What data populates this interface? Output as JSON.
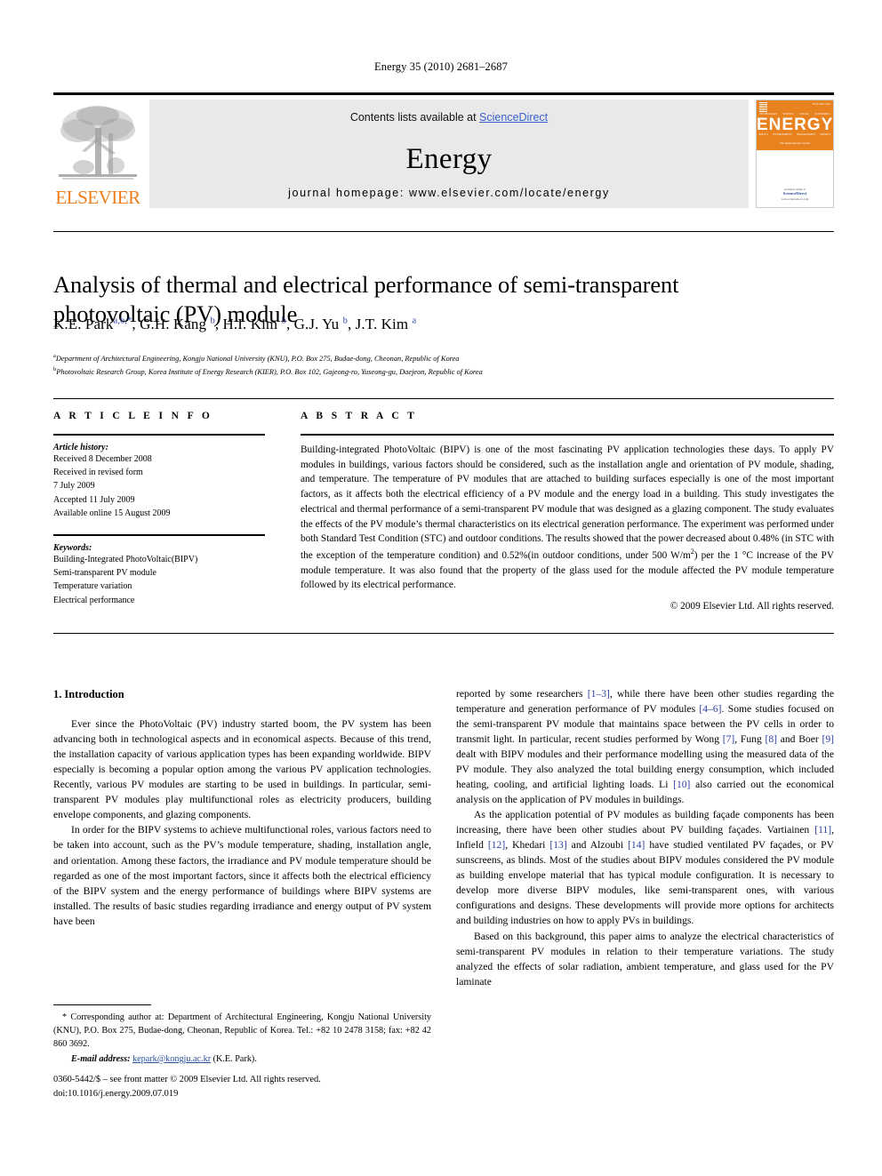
{
  "running_head": "Energy 35 (2010) 2681–2687",
  "masthead": {
    "publisher_wordmark": "ELSEVIER",
    "contents_prefix": "Contents lists available at ",
    "contents_link": "ScienceDirect",
    "journal_title": "Energy",
    "homepage": "journal homepage: www.elsevier.com/locate/energy",
    "cover": {
      "title": "ENERGY",
      "subtitle": "The International Journal",
      "issn": "ISSN 0360-5442",
      "topics_row1": [
        "TECHNOLOGY",
        "SCIENCE",
        "SOCIAL",
        "ECONOMICS"
      ],
      "topics_row2": [
        "POLICY",
        "ENVIRONMENT",
        "MANAGEMENT",
        "ENERGY"
      ],
      "footer_prefix": "Available online at",
      "footer_brand": "ScienceDirect",
      "footer_url": "www.sciencedirect.com"
    },
    "link_color": "#3a5fcd",
    "brand_orange": "#ef7d1a",
    "band_gray": "#e9e9e9"
  },
  "article": {
    "title": "Analysis of thermal and electrical performance of semi-transparent photovoltaic (PV) module",
    "authors_html": "K.E. Park<sup>a,b,*</sup>, G.H. Kang <sup>b</sup>, H.I. Kim <sup>b</sup>, G.J. Yu <sup>b</sup>, J.T. Kim <sup>a</sup>",
    "affiliations": [
      "Department of Architectural Engineering, Kongju National University (KNU), P.O. Box 275, Budae-dong, Cheonan, Republic of Korea",
      "Photovoltaic Research Group, Korea Institute of Energy Research (KIER), P.O. Box 102, Gajeong-ro, Yuseong-gu, Daejeon, Republic of Korea"
    ],
    "affiliation_markers": [
      "a",
      "b"
    ]
  },
  "article_info": {
    "heading": "A R T I C L E  I N F O",
    "history_label": "Article history:",
    "history": [
      "Received 8 December 2008",
      "Received in revised form",
      "7 July 2009",
      "Accepted 11 July 2009",
      "Available online 15 August 2009"
    ],
    "keywords_label": "Keywords:",
    "keywords": [
      "Building-Integrated PhotoVoltaic(BIPV)",
      "Semi-transparent PV module",
      "Temperature variation",
      "Electrical performance"
    ]
  },
  "abstract": {
    "heading": "A B S T R A C T",
    "body_html": "Building-integrated PhotoVoltaic (BIPV) is one of the most fascinating PV application technologies these days. To apply PV modules in buildings, various factors should be considered, such as the installation angle and orientation of PV module, shading, and temperature. The temperature of PV modules that are attached to building surfaces especially is one of the most important factors, as it affects both the electrical efficiency of a PV module and the energy load in a building. This study investigates the electrical and thermal performance of a semi-transparent PV module that was designed as a glazing component. The study evaluates the effects of the PV module&rsquo;s thermal characteristics on its electrical generation performance. The experiment was performed under both Standard Test Condition (STC) and outdoor conditions. The results showed that the power decreased about 0.48% (in STC with the exception of the temperature condition) and 0.52%(in outdoor conditions, under 500 W/m<sup>2</sup>) per the 1 &deg;C increase of the PV module temperature. It was also found that the property of the glass used for the module affected the PV module temperature followed by its electrical performance.",
    "copyright": "© 2009 Elsevier Ltd. All rights reserved."
  },
  "body": {
    "section_heading": "1.  Introduction",
    "left_paragraphs_html": [
      "Ever since the PhotoVoltaic (PV) industry started boom, the PV system has been advancing both in technological aspects and in economical aspects. Because of this trend, the installation capacity of various application types has been expanding worldwide. BIPV especially is becoming a popular option among the various PV application technologies. Recently, various PV modules are starting to be used in buildings. In particular, semi-transparent PV modules play multifunctional roles as electricity producers, building envelope components, and glazing components.",
      "In order for the BIPV systems to achieve multifunctional roles, various factors need to be taken into account, such as the PV&rsquo;s module temperature, shading, installation angle, and orientation. Among these factors, the irradiance and PV module temperature should be regarded as one of the most important factors, since it affects both the electrical efficiency of the BIPV system and the energy performance of buildings where BIPV systems are installed. The results of basic studies regarding irradiance and energy output of PV system have been"
    ],
    "right_paragraphs_html": [
      "reported by some researchers <span class=\"ref\">[1–3]</span>, while there have been other studies regarding the temperature and generation performance of PV modules <span class=\"ref\">[4–6]</span>. Some studies focused on the semi-transparent PV module that maintains space between the PV cells in order to transmit light. In particular, recent studies performed by Wong <span class=\"ref\">[7]</span>, Fung <span class=\"ref\">[8]</span> and Boer <span class=\"ref\">[9]</span> dealt with BIPV modules and their performance modelling using the measured data of the PV module. They also analyzed the total building energy consumption, which included heating, cooling, and artificial lighting loads. Li <span class=\"ref\">[10]</span> also carried out the economical analysis on the application of PV modules in buildings.",
      "As the application potential of PV modules as building fa&ccedil;ade components has been increasing, there have been other studies about PV building fa&ccedil;ades. Vartiainen <span class=\"ref\">[11]</span>, Infield <span class=\"ref\">[12]</span>, Khedari <span class=\"ref\">[13]</span> and Alzoubi <span class=\"ref\">[14]</span> have studied ventilated PV fa&ccedil;ades, or PV sunscreens, as blinds. Most of the studies about BIPV modules considered the PV module as building envelope material that has typical module configuration. It is necessary to develop more diverse BIPV modules, like semi-transparent ones, with various configurations and designs. These developments will provide more options for architects and building industries on how to apply PVs in buildings.",
      "Based on this background, this paper aims to analyze the electrical characteristics of semi-transparent PV modules in relation to their temperature variations. The study analyzed the effects of solar radiation, ambient temperature, and glass used for the PV laminate"
    ]
  },
  "footnote": {
    "corresponding_html": "* Corresponding author at: Department of Architectural Engineering, Kongju National University (KNU), P.O. Box 275, Budae-dong, Cheonan, Republic of Korea. Tel.: +82 10 2478 3158; fax: +82 42 860 3692.",
    "email_label": "E-mail address:",
    "email": "kepark@kongju.ac.kr",
    "email_owner": "(K.E. Park)."
  },
  "imprint": {
    "line1": "0360-5442/$ – see front matter © 2009 Elsevier Ltd. All rights reserved.",
    "line2": "doi:10.1016/j.energy.2009.07.019"
  }
}
